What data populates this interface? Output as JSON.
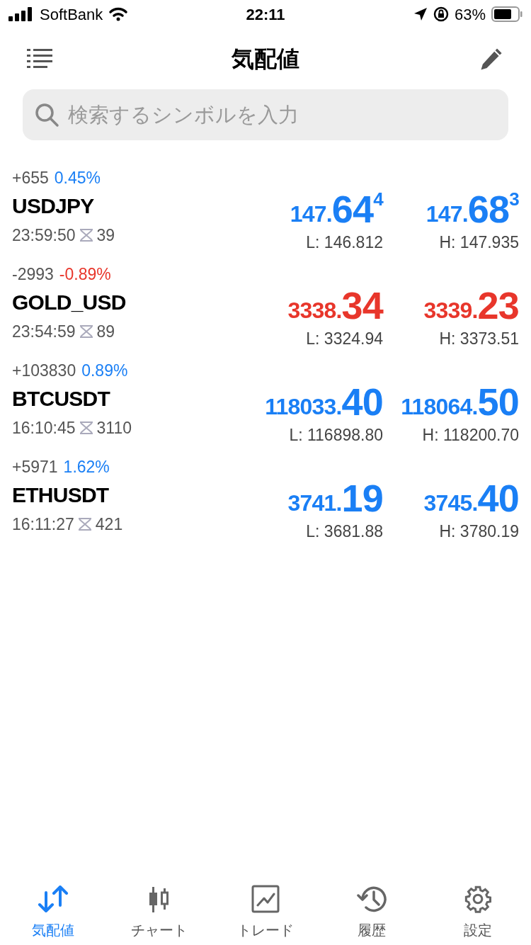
{
  "status_bar": {
    "carrier": "SoftBank",
    "time": "22:11",
    "battery": "63%"
  },
  "header": {
    "title": "気配値"
  },
  "search": {
    "placeholder": "検索するシンボルを入力"
  },
  "quotes": [
    {
      "symbol": "USDJPY",
      "change": "+655",
      "percent": "0.45%",
      "color": "#1a7ff5",
      "time": "23:59:50",
      "spread": "39",
      "bid": {
        "base": "147.",
        "big": "64",
        "sup": "4"
      },
      "ask": {
        "base": "147.",
        "big": "68",
        "sup": "3"
      },
      "low": "L: 146.812",
      "high": "H: 147.935"
    },
    {
      "symbol": "GOLD_USD",
      "change": "-2993",
      "percent": "-0.89%",
      "color": "#e8362b",
      "time": "23:54:59",
      "spread": "89",
      "bid": {
        "base": "3338.",
        "big": "34"
      },
      "ask": {
        "base": "3339.",
        "big": "23"
      },
      "low": "L: 3324.94",
      "high": "H: 3373.51"
    },
    {
      "symbol": "BTCUSDT",
      "change": "+103830",
      "percent": "0.89%",
      "color": "#1a7ff5",
      "time": "16:10:45",
      "spread": "3110",
      "bid": {
        "base": "118033.",
        "big": "40"
      },
      "ask": {
        "base": "118064.",
        "big": "50"
      },
      "low": "L: 116898.80",
      "high": "H: 118200.70"
    },
    {
      "symbol": "ETHUSDT",
      "change": "+5971",
      "percent": "1.62%",
      "color": "#1a7ff5",
      "time": "16:11:27",
      "spread": "421",
      "bid": {
        "base": "3741.",
        "big": "19"
      },
      "ask": {
        "base": "3745.",
        "big": "40"
      },
      "low": "L: 3681.88",
      "high": "H: 3780.19"
    }
  ],
  "tabs": [
    {
      "label": "気配値",
      "kind": "quotes",
      "selected": true
    },
    {
      "label": "チャート",
      "kind": "chart",
      "selected": false
    },
    {
      "label": "トレード",
      "kind": "trade",
      "selected": false
    },
    {
      "label": "履歴",
      "kind": "history",
      "selected": false
    },
    {
      "label": "設定",
      "kind": "settings",
      "selected": false
    }
  ]
}
